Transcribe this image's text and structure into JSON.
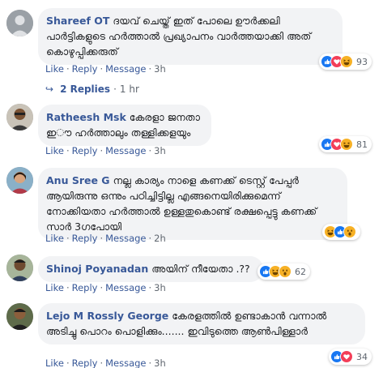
{
  "comments": [
    {
      "author": "Shareef OT",
      "text": "ദയവ് ചെയ്ത് ഇത് പോലെ ഊർക്കലി പാർട്ടികളുടെ ഹർത്താൽ പ്രഖ്യാപനം വാർത്തയാക്കി അത് കൊഴുപ്പിക്കരുത്",
      "like": "Like",
      "reply": "Reply",
      "message": "Message",
      "time": "3h",
      "reaction_count": "93",
      "reactions": [
        "like",
        "love",
        "haha"
      ]
    },
    {
      "author": "Ratheesh Msk",
      "text": "കേരളാ ജനതാ ഇൗ ഹർത്താലും തള്ളിക്കളയും",
      "like": "Like",
      "reply": "Reply",
      "message": "Message",
      "time": "3h",
      "reaction_count": "81",
      "reactions": [
        "like",
        "love",
        "haha"
      ]
    },
    {
      "author": "Anu Sree G",
      "text": "നല്ല കാര്യം നാളെ കണക്ക് ടെസ്റ്റ് പേപ്പർ ആയിരുന്നു ഒന്നും പഠിച്ചിട്ടില്ല എങ്ങനെയിരിക്കുമെന്ന് നോക്കിയതാ ഹർത്താൽ ഉള്ളതുകൊണ്ട് രക്ഷപ്പെട്ടു കണക്ക് സാർ 3ഗപോയി",
      "like": "Like",
      "reply": "Reply",
      "message": "Message",
      "time": "2h",
      "reaction_count": "",
      "reactions": [
        "haha",
        "like",
        "wow"
      ]
    },
    {
      "author": "Shinoj Poyanadan",
      "text": "അയിന് നീയേതാ .??",
      "like": "Like",
      "reply": "Reply",
      "message": "Message",
      "time": "3h",
      "reaction_count": "62",
      "reactions": [
        "like",
        "haha",
        "wow"
      ]
    },
    {
      "author": "Lejo M Rossly George",
      "text": "കേരളത്തിൽ ഉണ്ടാകാൻ വന്നാൽ അടിച്ചു പൊറം പൊളിക്കും....... ഇവിടുത്തെ ആൺപിള്ളാർ",
      "like": "Like",
      "reply": "Reply",
      "message": "Message",
      "time": "3h",
      "reaction_count": "34",
      "reactions": [
        "like",
        "love"
      ]
    }
  ],
  "replies_link": {
    "label": "2 Replies",
    "time": "1 hr"
  },
  "colors": {
    "link": "#385898",
    "meta": "#606770",
    "bubble": "#f2f3f5",
    "like": "#1877f2",
    "love": "#f33e58",
    "haha": "#f7b125"
  }
}
